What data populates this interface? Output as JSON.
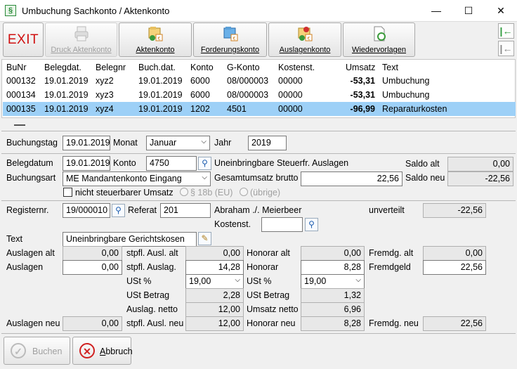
{
  "window": {
    "title": "Umbuchung Sachkonto / Aktenkonto",
    "minimize": "—",
    "maximize": "☐",
    "close": "✕"
  },
  "toolbar": {
    "exit": "EXIT",
    "druck": "Druck Aktenkonto",
    "aktenkonto": "Aktenkonto",
    "forderungskonto": "Forderungskonto",
    "auslagenkonto": "Auslagenkonto",
    "wiedervorlagen": "Wiedervorlagen",
    "side_first": "|←",
    "side_prev": "|←"
  },
  "grid": {
    "headers": [
      "BuNr",
      "Belegdat.",
      "Belegnr",
      "Buch.dat.",
      "Konto",
      "G-Konto",
      "Kostenst.",
      "Umsatz",
      "Text"
    ],
    "rows": [
      [
        "000132",
        "19.01.2019",
        "xyz2",
        "19.01.2019",
        "6000",
        "08/000003",
        "00000",
        "-53,31",
        "Umbuchung"
      ],
      [
        "000134",
        "19.01.2019",
        "xyz3",
        "19.01.2019",
        "6000",
        "08/000003",
        "00000",
        "-53,31",
        "Umbuchung"
      ],
      [
        "000135",
        "19.01.2019",
        "xyz4",
        "19.01.2019",
        "1202",
        "4501",
        "00000",
        "-96,99",
        "Reparaturkosten"
      ]
    ]
  },
  "form": {
    "buchungstag_label": "Buchungstag",
    "buchungstag": "19.01.2019",
    "monat_label": "Monat",
    "monat": "Januar",
    "jahr_label": "Jahr",
    "jahr": "2019",
    "belegdatum_label": "Belegdatum",
    "belegdatum": "19.01.2019",
    "konto_label": "Konto",
    "konto": "4750",
    "konto_name": "Uneinbringbare Steuerfr. Auslagen",
    "saldo_alt_label": "Saldo alt",
    "saldo_alt": "0,00",
    "buchungsart_label": "Buchungsart",
    "buchungsart": "ME Mandantenkonto Eingang",
    "gesamtumsatz_label": "Gesamtumsatz brutto",
    "gesamtumsatz": "22,56",
    "saldo_neu_label": "Saldo neu",
    "saldo_neu": "-22,56",
    "nicht_steuerbar": "nicht steuerbarer Umsatz",
    "radio_18b": "§ 18b (EU)",
    "radio_uebrige": "(übrige)",
    "registernr_label": "Registernr.",
    "registernr": "19/000010",
    "referat_label": "Referat",
    "referat": "201",
    "mandant": "Abraham ./. Meierbeer",
    "unverteilt_label": "unverteilt",
    "unverteilt": "-22,56",
    "kostenst_label": "Kostenst.",
    "kostenst": "",
    "text_label": "Text",
    "text": "Uneinbringbare Gerichtskosen",
    "auslagen_alt_label": "Auslagen alt",
    "auslagen_alt": "0,00",
    "stpfl_ausl_alt_label": "stpfl. Ausl. alt",
    "stpfl_ausl_alt": "0,00",
    "honorar_alt_label": "Honorar alt",
    "honorar_alt": "0,00",
    "fremdg_alt_label": "Fremdg. alt",
    "fremdg_alt": "0,00",
    "auslagen_label": "Auslagen",
    "auslagen": "0,00",
    "stpfl_auslag_label": "stpfl. Auslag.",
    "stpfl_auslag": "14,28",
    "honorar_label": "Honorar",
    "honorar": "8,28",
    "fremdgeld_label": "Fremdgeld",
    "fremdgeld": "22,56",
    "ust1_label": "USt %",
    "ust1": "19,00",
    "ust2_label": "USt %",
    "ust2": "19,00",
    "ust_betrag1_label": "USt Betrag",
    "ust_betrag1": "2,28",
    "ust_betrag2_label": "USt Betrag",
    "ust_betrag2": "1,32",
    "auslag_netto_label": "Auslag. netto",
    "auslag_netto": "12,00",
    "umsatz_netto_label": "Umsatz netto",
    "umsatz_netto": "6,96",
    "auslagen_neu_label": "Auslagen neu",
    "auslagen_neu": "0,00",
    "stpfl_ausl_neu_label": "stpfl. Ausl. neu",
    "stpfl_ausl_neu": "12,00",
    "honorar_neu_label": "Honorar neu",
    "honorar_neu": "8,28",
    "fremdg_neu_label": "Fremdg. neu",
    "fremdg_neu": "22,56"
  },
  "buttons": {
    "buchen": "Buchen",
    "abbruch": "Abbruch",
    "abbruch_mnemonic": "A",
    "abbruch_rest": "bbruch"
  },
  "colors": {
    "selection": "#9dd0f7",
    "exit": "#d01010",
    "accent": "#2a8a3a"
  }
}
